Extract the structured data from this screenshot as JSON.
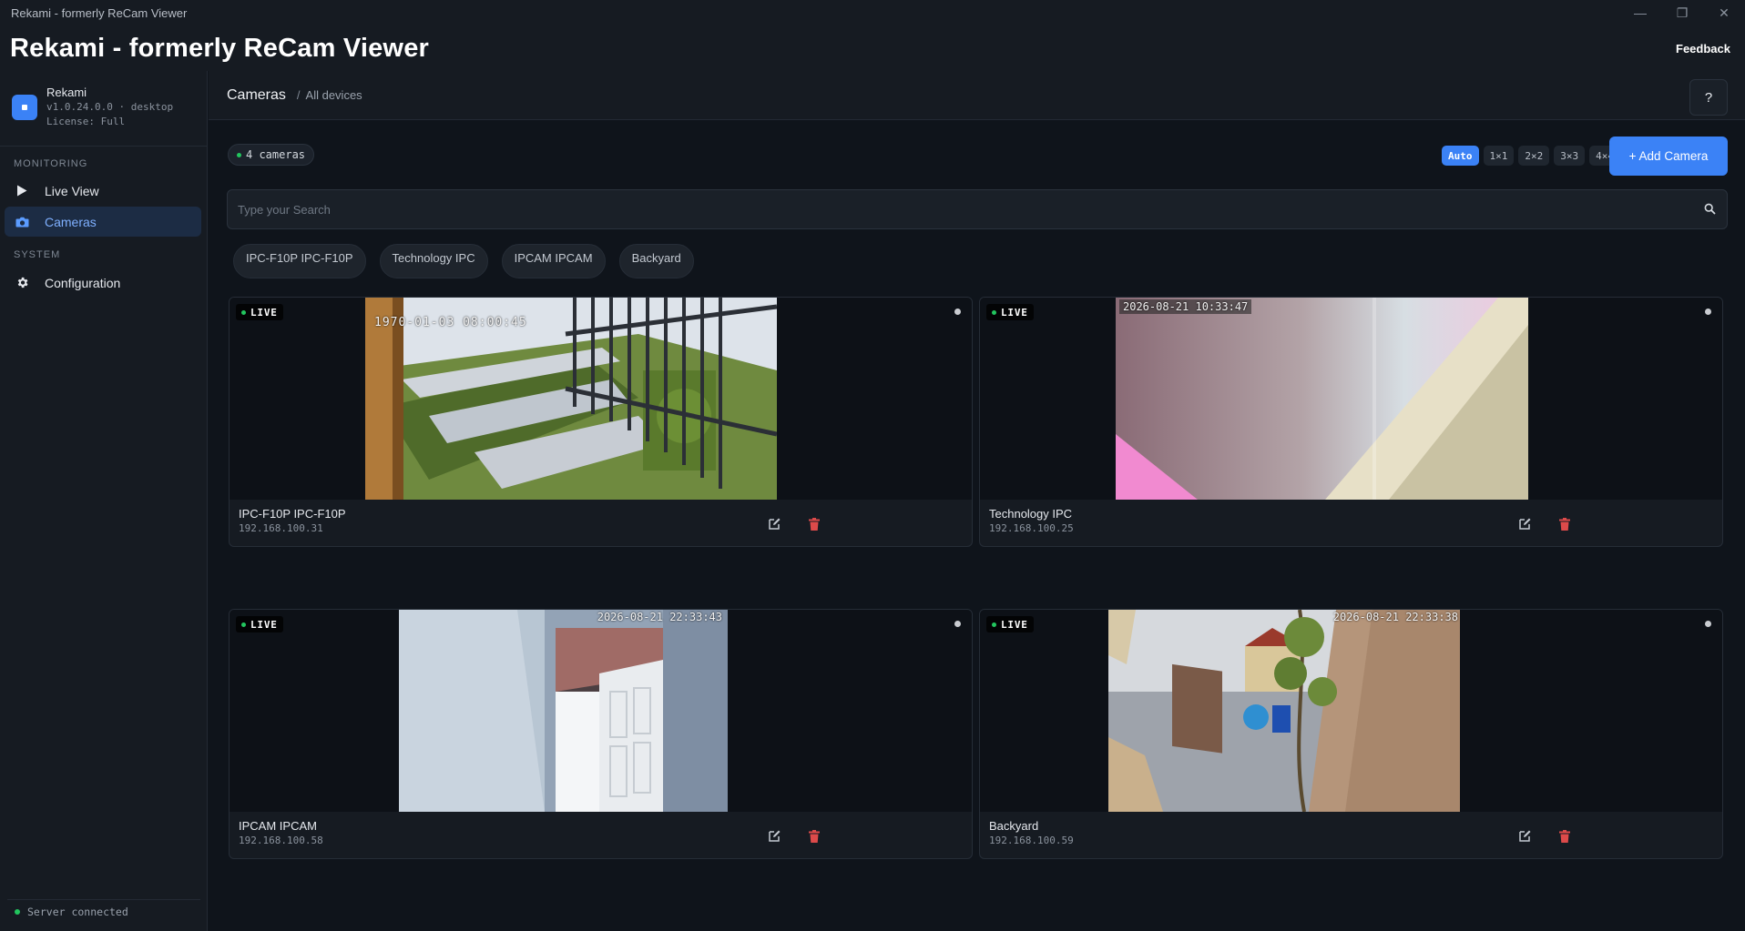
{
  "window": {
    "title": "Rekami - formerly ReCam Viewer",
    "controls": [
      "—",
      "❐",
      "✕"
    ]
  },
  "header": {
    "title": "Rekami - formerly ReCam Viewer",
    "feedback_label": "Feedback"
  },
  "sidebar": {
    "brand": {
      "name": "Rekami",
      "version": "v1.0.24.0.0 · desktop",
      "license": "License: Full"
    },
    "sections": [
      {
        "label": "MONITORING",
        "items": [
          {
            "label": "Live View",
            "icon": "play-icon"
          },
          {
            "label": "Cameras",
            "icon": "camera-icon",
            "active": true
          }
        ]
      },
      {
        "label": "SYSTEM",
        "items": [
          {
            "label": "Configuration",
            "icon": "gear-icon"
          }
        ]
      }
    ],
    "server_status": "Server connected"
  },
  "breadcrumb": {
    "main": "Cameras",
    "separator": "/",
    "sub": "All devices",
    "help_label": "?"
  },
  "toolbar": {
    "count_label": "4 cameras",
    "layouts": [
      "Auto",
      "1×1",
      "2×2",
      "3×3",
      "4×4"
    ],
    "active_layout": "Auto",
    "add_label": "+ Add Camera"
  },
  "search": {
    "placeholder": "Type your Search",
    "value": ""
  },
  "filters": [
    "IPC-F10P IPC-F10P",
    "Technology IPC",
    "IPCAM IPCAM",
    "Backyard"
  ],
  "cameras": [
    {
      "name": "IPC-F10P IPC-F10P",
      "ip": "192.168.100.31",
      "live_label": "LIVE",
      "osd": "1970-01-03 08:00:45"
    },
    {
      "name": "Technology IPC",
      "ip": "192.168.100.25",
      "live_label": "LIVE",
      "osd": "2026-08-21  10:33:47"
    },
    {
      "name": "IPCAM IPCAM",
      "ip": "192.168.100.58",
      "live_label": "LIVE",
      "osd": "2026-08-21  22:33:43"
    },
    {
      "name": "Backyard",
      "ip": "192.168.100.59",
      "live_label": "LIVE",
      "osd": "2026-08-21  22:33:38"
    }
  ],
  "colors": {
    "accent": "#3b82f6",
    "live_green": "#22c55e",
    "delete_red": "#dc4a4a"
  }
}
